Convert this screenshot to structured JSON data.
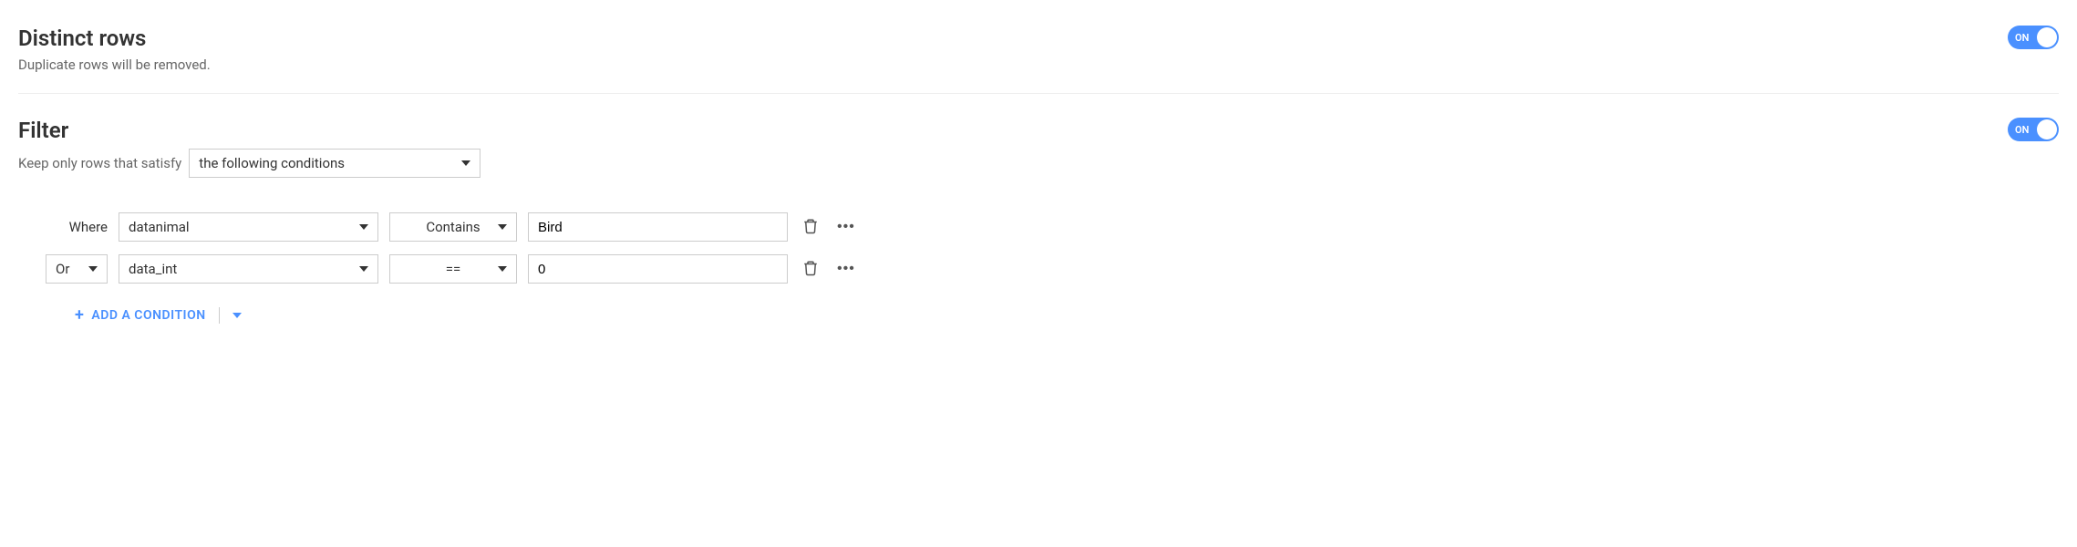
{
  "distinct": {
    "title": "Distinct rows",
    "description": "Duplicate rows will be removed.",
    "toggle_state": "ON"
  },
  "filter": {
    "title": "Filter",
    "description_prefix": "Keep only rows that satisfy",
    "mode_select": "the following conditions",
    "toggle_state": "ON",
    "where_label": "Where",
    "conditions": [
      {
        "junction": null,
        "column": "datanimal",
        "operator": "Contains",
        "value": "Bird"
      },
      {
        "junction": "Or",
        "column": "data_int",
        "operator": "==",
        "value": "0"
      }
    ],
    "add_button": "ADD A CONDITION"
  }
}
